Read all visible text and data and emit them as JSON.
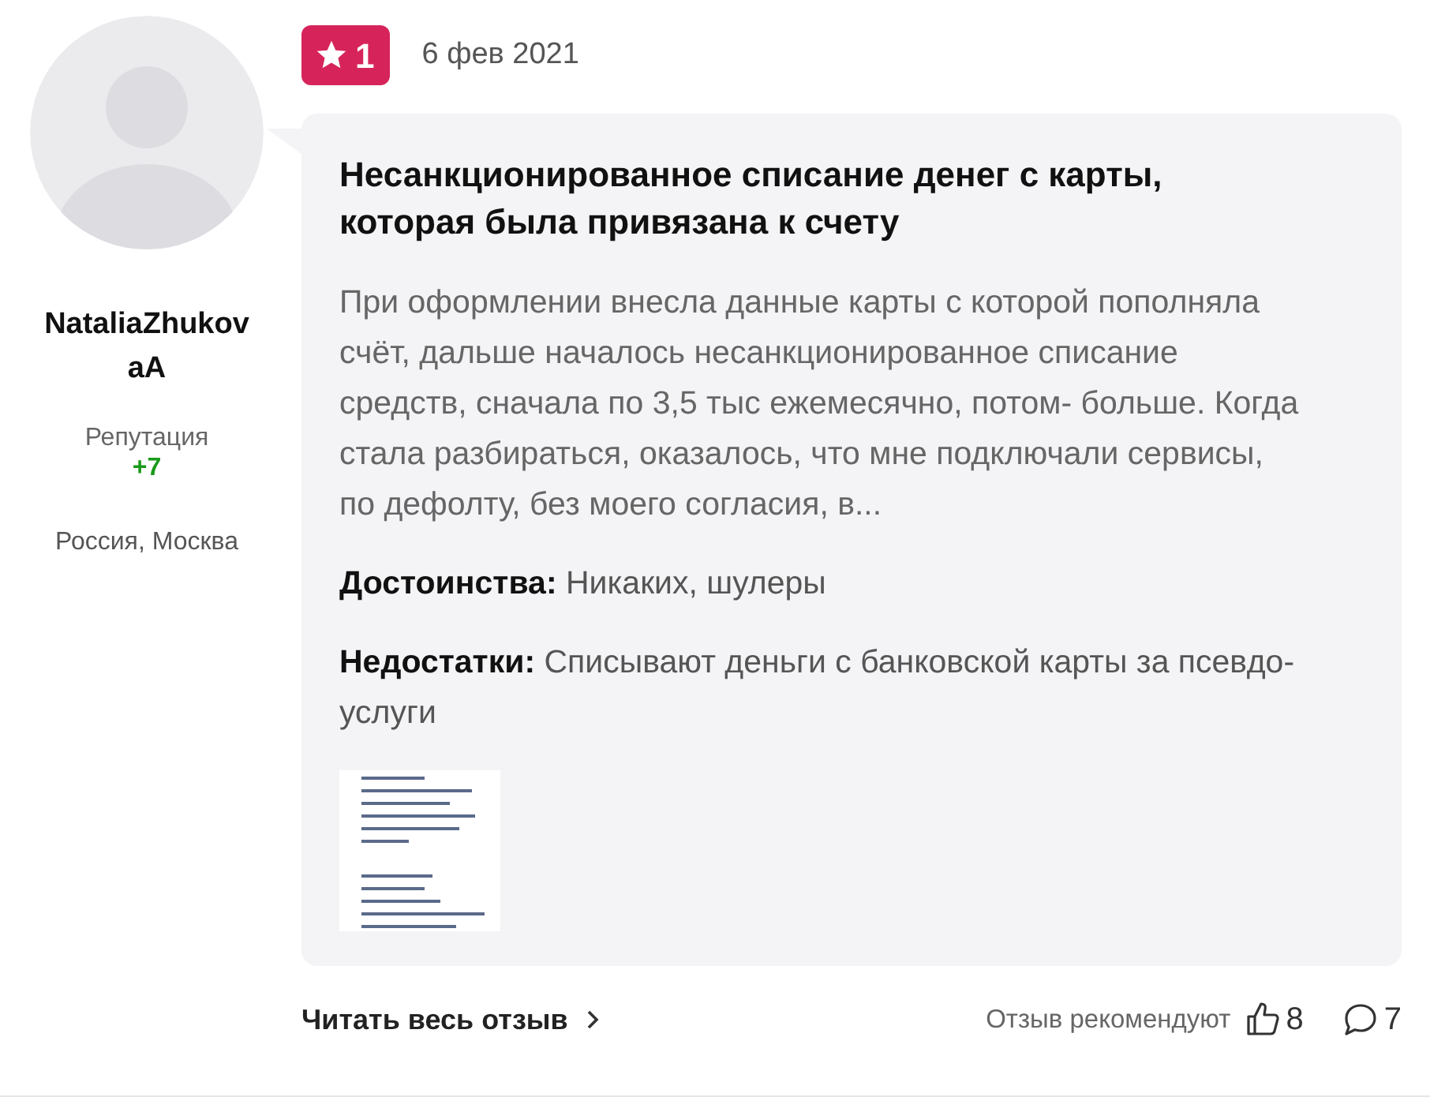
{
  "author": {
    "name": "NataliaZhukovaA",
    "reputation_label": "Репутация",
    "reputation_value": "+7",
    "location": "Россия, Москва"
  },
  "review": {
    "rating": "1",
    "date": "6 фев 2021",
    "title": "Несанкционированное списание денег с карты, которая была привязана к счету",
    "text": "При оформлении внесла данные карты с которой пополняла счёт, дальше началось несанкционированное списание средств, сначала по 3,5 тыс ежемесячно, потом- больше. Когда стала разбираться, оказалось, что мне подключали сервисы, по дефолту, без моего согласия, в...",
    "pros": "**Достоинства:** Никаких, шулеры",
    "cons": "**Недостатки:** Списывают деньги с банковской карты за псевдо-услуги"
  },
  "footer": {
    "read_more": "Читать весь отзыв",
    "recommend_label": "Отзыв рекомендуют",
    "likes": "8",
    "comments": "7"
  }
}
